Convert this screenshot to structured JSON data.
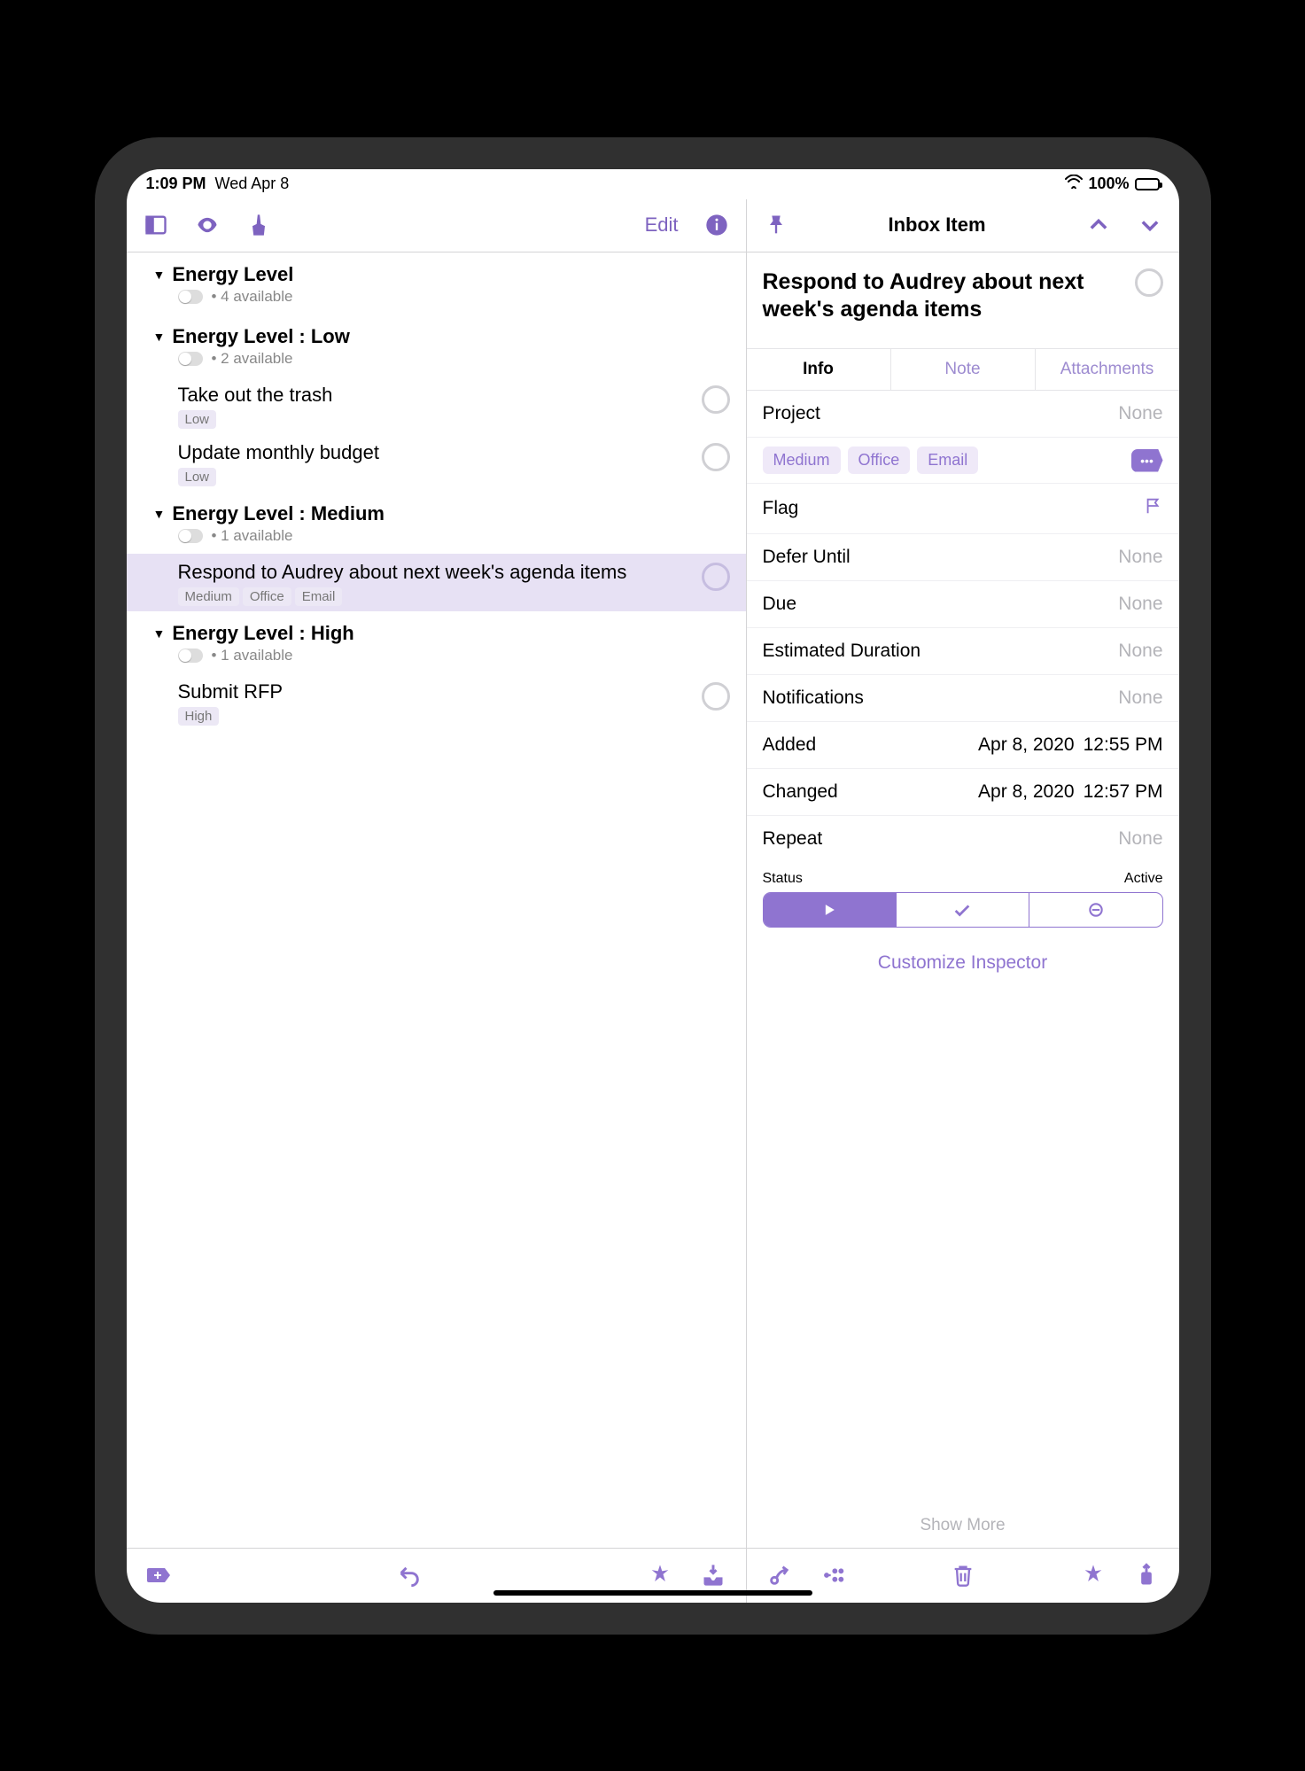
{
  "statusbar": {
    "time": "1:09 PM",
    "date": "Wed Apr 8",
    "battery_pct": "100%"
  },
  "topbar": {
    "edit": "Edit",
    "inspector_title": "Inbox Item"
  },
  "groups": [
    {
      "title": "Energy Level",
      "available": "4 available",
      "tasks": []
    },
    {
      "title": "Energy Level : Low",
      "available": "2 available",
      "tasks": [
        {
          "title": "Take out the trash",
          "tags": [
            "Low"
          ],
          "selected": false
        },
        {
          "title": "Update monthly budget",
          "tags": [
            "Low"
          ],
          "selected": false
        }
      ]
    },
    {
      "title": "Energy Level : Medium",
      "available": "1 available",
      "tasks": [
        {
          "title": "Respond to Audrey about next week's agenda items",
          "tags": [
            "Medium",
            "Office",
            "Email"
          ],
          "selected": true
        }
      ]
    },
    {
      "title": "Energy Level : High",
      "available": "1 available",
      "tasks": [
        {
          "title": "Submit RFP",
          "tags": [
            "High"
          ],
          "selected": false
        }
      ]
    }
  ],
  "inspector": {
    "item_title": "Respond to Audrey about next week's agenda items",
    "tabs": {
      "info": "Info",
      "note": "Note",
      "attachments": "Attachments"
    },
    "project": {
      "label": "Project",
      "value": "None"
    },
    "tags": [
      "Medium",
      "Office",
      "Email"
    ],
    "flag_label": "Flag",
    "defer": {
      "label": "Defer Until",
      "value": "None"
    },
    "due": {
      "label": "Due",
      "value": "None"
    },
    "estimated": {
      "label": "Estimated Duration",
      "value": "None"
    },
    "notifications": {
      "label": "Notifications",
      "value": "None"
    },
    "added": {
      "label": "Added",
      "date": "Apr 8, 2020",
      "time": "12:55 PM"
    },
    "changed": {
      "label": "Changed",
      "date": "Apr 8, 2020",
      "time": "12:57 PM"
    },
    "repeat": {
      "label": "Repeat",
      "value": "None"
    },
    "status": {
      "label": "Status",
      "active_label": "Active"
    },
    "customize": "Customize Inspector",
    "show_more": "Show More"
  }
}
